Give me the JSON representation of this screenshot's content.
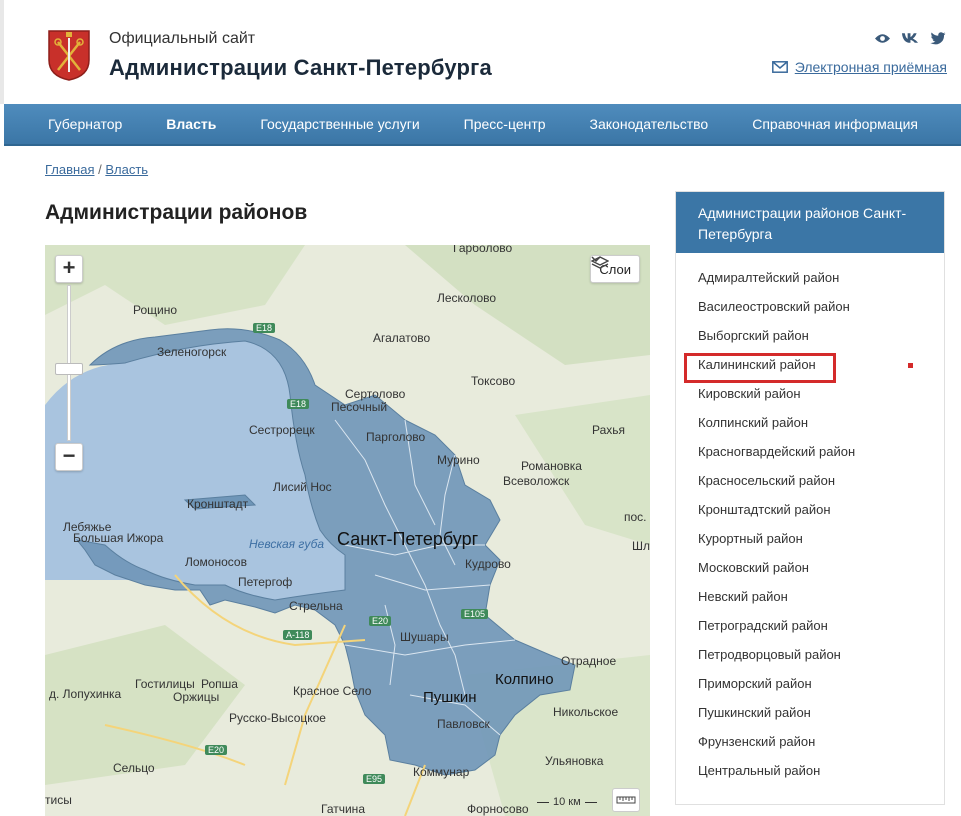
{
  "header": {
    "subtitle": "Официальный сайт",
    "title": "Администрации Санкт-Петербурга",
    "reception_label": "Электронная приёмная",
    "social_icons": [
      "eye-icon",
      "vk-icon",
      "twitter-icon"
    ]
  },
  "nav": {
    "items": [
      {
        "label": "Губернатор"
      },
      {
        "label": "Власть"
      },
      {
        "label": "Государственные услуги"
      },
      {
        "label": "Пресс-центр"
      },
      {
        "label": "Законодательство"
      },
      {
        "label": "Справочная информация"
      }
    ],
    "active": "Власть"
  },
  "breadcrumb": {
    "home": "Главная",
    "sep": "/",
    "current": "Власть"
  },
  "page_title": "Администрации районов",
  "map": {
    "zoom_in": "+",
    "zoom_out": "−",
    "layers_label": "Слои",
    "scale_label": "10 км",
    "labels": {
      "city": "Санкт-Петербург",
      "pushkin": "Пушкин",
      "kolpino": "Колпино",
      "bay": "Невская губа",
      "places": [
        "Гарболово",
        "Лесколово",
        "Рощино",
        "Агалатово",
        "Зеленогорск",
        "Сертолово",
        "Песочный",
        "Токсово",
        "Сестрорецк",
        "Парголово",
        "Рахья",
        "Мурино",
        "Романовка",
        "Всеволожск",
        "Лисий Нос",
        "Кронштадт",
        "Лебяжье",
        "Большая Ижора",
        "пос.",
        "Кудрово",
        "Шл",
        "Ломоносов",
        "Петергоф",
        "Стрельна",
        "Шушары",
        "Отрадное",
        "Гостилицы",
        "Ропша",
        "д. Лопухинка",
        "Оржицы",
        "Красное Село",
        "Никольское",
        "Русско-Высоцкое",
        "Павловск",
        "Ульяновка",
        "Сельцо",
        "Коммунар",
        "тисы",
        "Гатчина",
        "Форносово"
      ],
      "roads": [
        "E18",
        "E18",
        "A-118",
        "E20",
        "E105",
        "E20",
        "E95"
      ]
    }
  },
  "sidebar": {
    "heading": "Администрации районов Санкт-Петербурга",
    "items": [
      "Адмиралтейский район",
      "Василеостровский район",
      "Выборгский район",
      "Калининский район",
      "Кировский район",
      "Колпинский район",
      "Красногвардейский район",
      "Красносельский район",
      "Кронштадтский район",
      "Курортный район",
      "Московский район",
      "Невский район",
      "Петроградский район",
      "Петродворцовый район",
      "Приморский район",
      "Пушкинский район",
      "Фрунзенский район",
      "Центральный район"
    ],
    "highlighted": "Калининский район"
  },
  "colors": {
    "nav_bg": "#3b76a6",
    "link": "#3a6a9c",
    "highlight": "#d42a2a",
    "city_fill": "#6f96b8",
    "water": "#a9c4df"
  }
}
